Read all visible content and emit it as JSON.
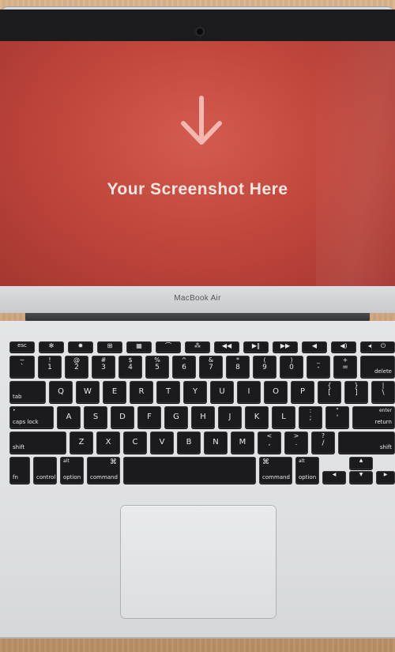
{
  "screen": {
    "placeholder_text": "Your Screenshot Here",
    "background_color": "#c0463c",
    "arrow_icon": "arrow-down-icon"
  },
  "device": {
    "brand_label": "MacBook Air"
  },
  "keyboard": {
    "function_row": [
      "esc",
      "",
      "",
      "",
      "",
      "",
      "",
      "",
      "",
      "",
      "",
      "",
      ""
    ],
    "number_row": [
      {
        "top": "~",
        "bot": "`"
      },
      {
        "top": "!",
        "bot": "1"
      },
      {
        "top": "@",
        "bot": "2"
      },
      {
        "top": "#",
        "bot": "3"
      },
      {
        "top": "$",
        "bot": "4"
      },
      {
        "top": "%",
        "bot": "5"
      },
      {
        "top": "^",
        "bot": "6"
      },
      {
        "top": "&",
        "bot": "7"
      },
      {
        "top": "*",
        "bot": "8"
      },
      {
        "top": "(",
        "bot": "9"
      },
      {
        "top": ")",
        "bot": "0"
      },
      {
        "top": "_",
        "bot": "-"
      },
      {
        "top": "+",
        "bot": "="
      }
    ],
    "delete_label": "delete",
    "tab_label": "tab",
    "qwerty_row": [
      "Q",
      "W",
      "E",
      "R",
      "T",
      "Y",
      "U",
      "I",
      "O",
      "P"
    ],
    "bracket_keys": [
      {
        "top": "{",
        "bot": "["
      },
      {
        "top": "}",
        "bot": "]"
      },
      {
        "top": "|",
        "bot": "\\"
      }
    ],
    "caps_lock_label": "caps lock",
    "home_row": [
      "A",
      "S",
      "D",
      "F",
      "G",
      "H",
      "J",
      "K",
      "L"
    ],
    "home_punct": [
      {
        "top": ":",
        "bot": ";"
      },
      {
        "top": "\"",
        "bot": "'"
      }
    ],
    "return_labels": {
      "top": "enter",
      "bot": "return"
    },
    "shift_label": "shift",
    "bottom_letter_row": [
      "Z",
      "X",
      "C",
      "V",
      "B",
      "N",
      "M"
    ],
    "bottom_punct": [
      {
        "top": "<",
        "bot": ","
      },
      {
        "top": ">",
        "bot": "."
      },
      {
        "top": "?",
        "bot": "/"
      }
    ],
    "modifiers": {
      "fn": "fn",
      "control": "control",
      "option": "option",
      "alt": "alt",
      "command": "command",
      "command_symbol": "⌘"
    },
    "arrows": {
      "left": "◀",
      "up": "▲",
      "down": "▼",
      "right": "▶"
    }
  }
}
